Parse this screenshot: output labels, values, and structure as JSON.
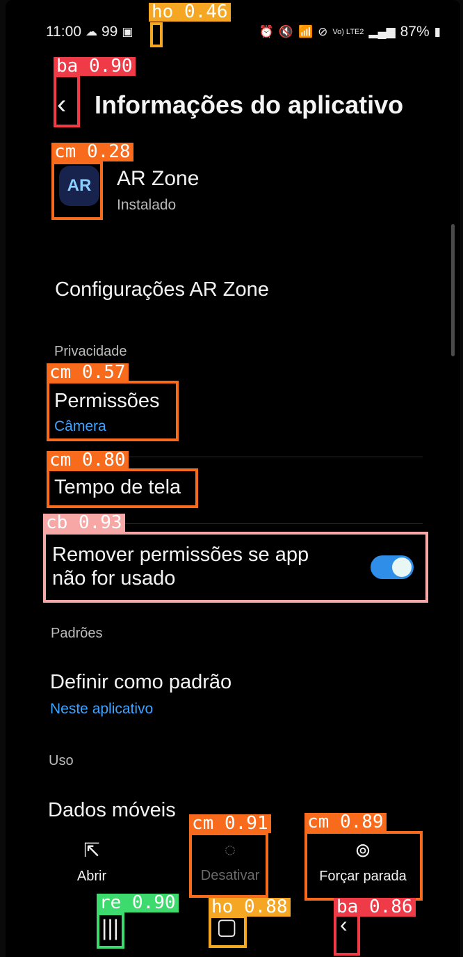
{
  "status_bar": {
    "time": "11:00",
    "cloud_icon": "cloud-icon",
    "notif_count": "99",
    "battery": "87%",
    "alarm_icon": "alarm-icon",
    "mute_icon": "mute-icon",
    "wifi_icon": "wifi-icon",
    "dnd_icon": "do-not-disturb-icon",
    "volte": "Vo) LTE2",
    "signal_icon": "signal-icon"
  },
  "header": {
    "title": "Informações do aplicativo"
  },
  "app": {
    "name": "AR Zone",
    "status": "Instalado",
    "icon_text": "AR"
  },
  "settings_row": {
    "title": "Configurações AR Zone"
  },
  "privacy": {
    "section": "Privacidade",
    "permissions_title": "Permissões",
    "permissions_sub": "Câmera",
    "screen_time": "Tempo de tela",
    "remove_perm_line1": "Remover permissões se app",
    "remove_perm_line2": "não for usado",
    "remove_perm_enabled": true
  },
  "defaults": {
    "section": "Padrões",
    "title": "Definir como padrão",
    "sub": "Neste aplicativo"
  },
  "usage": {
    "section": "Uso",
    "mobile_data": "Dados móveis"
  },
  "actions": {
    "open": "Abrir",
    "disable": "Desativar",
    "force_stop": "Forçar parada"
  },
  "detections": {
    "ho_top": "ho 0.46",
    "ba_back": "ba 0.90",
    "cm_icon": "cm 0.28",
    "cm_perm": "cm 0.57",
    "cm_tempo": "cm 0.80",
    "cb_toggle": "cb 0.93",
    "cm_disable": "cm 0.91",
    "cm_force": "cm 0.89",
    "re_recent": "re 0.90",
    "ho_home": "ho 0.88",
    "ba_nav": "ba 0.86"
  },
  "colors": {
    "accent_blue": "#3ea3ff",
    "toggle_on": "#2f8fe8",
    "box_ho": "#f5a623",
    "box_ba": "#ef3b47",
    "box_cm": "#f86b1d",
    "box_cb": "#f6a7a6",
    "box_re": "#3ddb6e"
  }
}
